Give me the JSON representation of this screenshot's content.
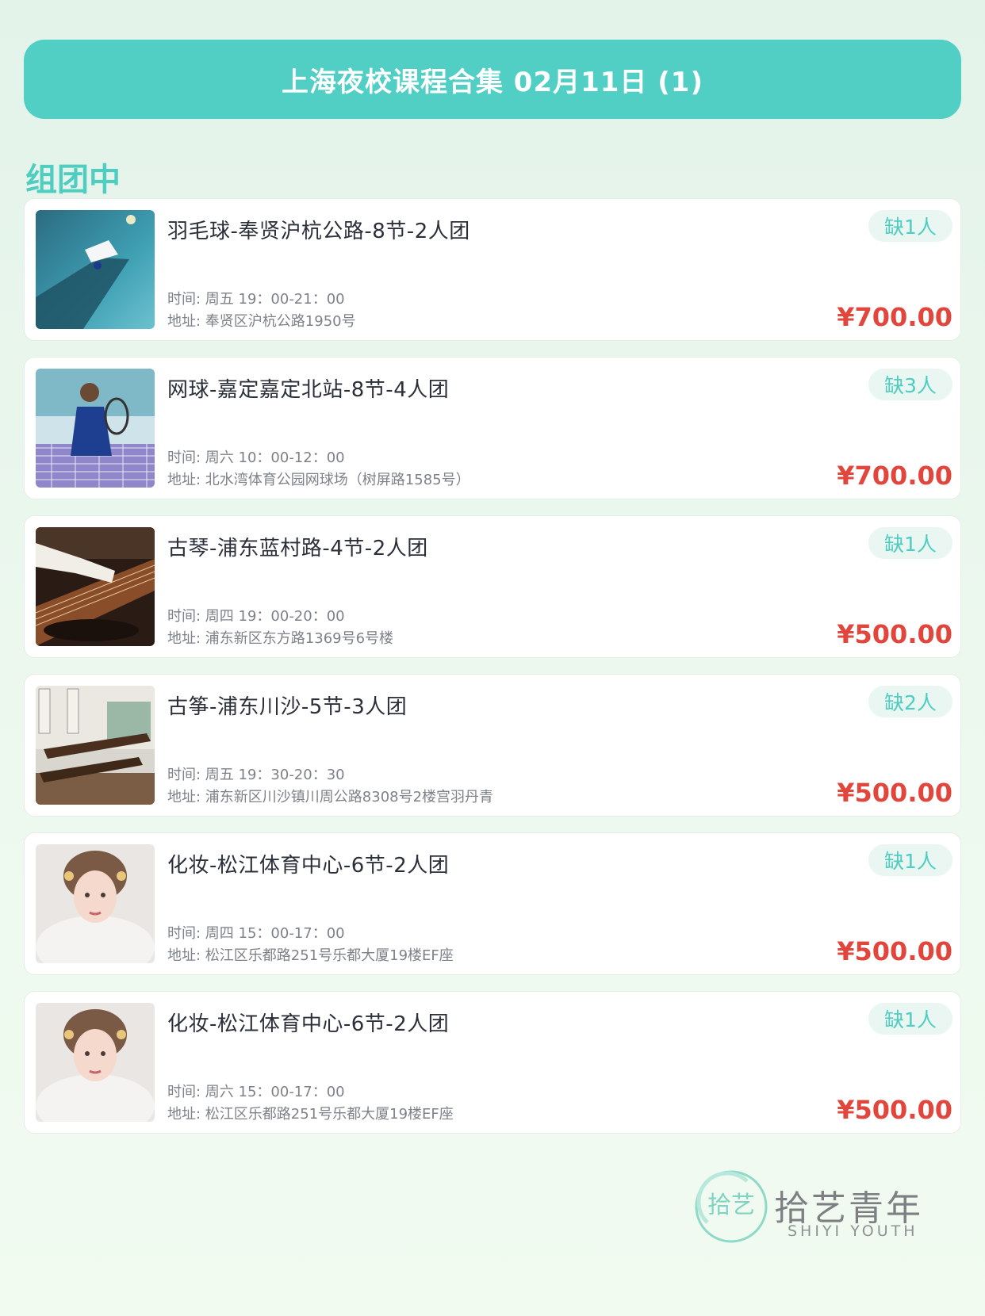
{
  "header": {
    "title": "上海夜校课程合集 02月11日 (1)"
  },
  "section": {
    "title": "组团中"
  },
  "courses": [
    {
      "title": "羽毛球-奉贤沪杭公路-8节-2人团",
      "time": "时间: 周五 19：00-21：00",
      "address": "地址: 奉贤区沪杭公路1950号",
      "badge": "缺1人",
      "price": "¥700.00",
      "image": "badminton"
    },
    {
      "title": "网球-嘉定嘉定北站-8节-4人团",
      "time": "时间: 周六 10：00-12：00",
      "address": "地址: 北水湾体育公园网球场（树屏路1585号）",
      "badge": "缺3人",
      "price": "¥700.00",
      "image": "tennis"
    },
    {
      "title": "古琴-浦东蓝村路-4节-2人团",
      "time": "时间: 周四 19：00-20：00",
      "address": "地址: 浦东新区东方路1369号6号楼",
      "badge": "缺1人",
      "price": "¥500.00",
      "image": "guqin"
    },
    {
      "title": "古筝-浦东川沙-5节-3人团",
      "time": "时间: 周五 19：30-20：30",
      "address": "地址: 浦东新区川沙镇川周公路8308号2楼宫羽丹青",
      "badge": "缺2人",
      "price": "¥500.00",
      "image": "guzheng"
    },
    {
      "title": "化妆-松江体育中心-6节-2人团",
      "time": "时间: 周四 15：00-17：00",
      "address": "地址: 松江区乐都路251号乐都大厦19楼EF座",
      "badge": "缺1人",
      "price": "¥500.00",
      "image": "makeup"
    },
    {
      "title": "化妆-松江体育中心-6节-2人团",
      "time": "时间: 周六 15：00-17：00",
      "address": "地址: 松江区乐都路251号乐都大厦19楼EF座",
      "badge": "缺1人",
      "price": "¥500.00",
      "image": "makeup"
    }
  ],
  "brand": {
    "logo_char": "拾艺",
    "name_cn": "拾艺青年",
    "name_en": "SHIYI YOUTH"
  },
  "colors": {
    "accent": "#52cfc4",
    "price": "#e2453c",
    "badge_bg": "#e9f6f1"
  }
}
